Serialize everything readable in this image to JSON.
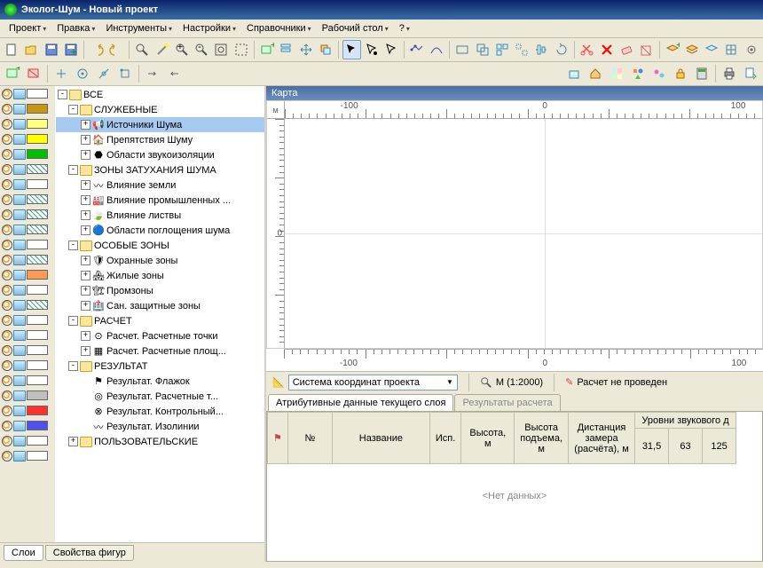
{
  "titlebar": {
    "text": "Эколог-Шум - Новый проект"
  },
  "menu": {
    "project": "Проект",
    "edit": "Правка",
    "tools": "Инструменты",
    "settings": "Настройки",
    "refs": "Справочники",
    "desktop": "Рабочий стол",
    "help": "?"
  },
  "left_tabs": {
    "layers": "Слои",
    "props": "Свойства фигур"
  },
  "tree": {
    "all": "ВСЕ",
    "service": "СЛУЖЕБНЫЕ",
    "noise_sources": "Источники Шума",
    "obstacles": "Препятствия Шуму",
    "sound_iso": "Области звукоизоляции",
    "atten_zones": "ЗОНЫ ЗАТУХАНИЯ ШУМА",
    "ground": "Влияние земли",
    "industrial": "Влияние промышленных ...",
    "foliage": "Влияние листвы",
    "absorb": "Области поглощения шума",
    "special": "ОСОБЫЕ ЗОНЫ",
    "protected": "Охранные зоны",
    "residential": "Жилые зоны",
    "industrial_z": "Промзоны",
    "sanitary": "Сан. защитные зоны",
    "calc": "РАСЧЕТ",
    "calc_points": "Расчет. Расчетные точки",
    "calc_areas": "Расчет. Расчетные площ...",
    "result": "РЕЗУЛЬТАТ",
    "res_flag": "Результат. Флажок",
    "res_points": "Результат. Расчетные т...",
    "res_control": "Результат. Контрольный...",
    "res_iso": "Результат. Изолинии",
    "user": "ПОЛЬЗОВАТЕЛЬСКИЕ"
  },
  "swatch_colors": [
    "#ffffff",
    "#c89614",
    "#ffff80",
    "#ffff00",
    "#00c000",
    "#ffffff",
    "#ffffff",
    "#ffffff",
    "#ffffff",
    "#ffffff",
    "#ffffff",
    "#ffffff",
    "#ff9955",
    "#ffffff",
    "#ffffff",
    "#ffffff",
    "#ffffff",
    "#ffffff",
    "#ffffff",
    "#ffffff",
    "#c0c0c0",
    "#ff3030",
    "#5050f0",
    "#ffffff",
    "#ffffff"
  ],
  "swatch_hatches": [
    false,
    false,
    false,
    false,
    false,
    true,
    false,
    true,
    true,
    true,
    false,
    true,
    false,
    false,
    true,
    false,
    false,
    false,
    false,
    false,
    false,
    false,
    false,
    false,
    false
  ],
  "map": {
    "title": "Карта",
    "unit": "м",
    "ticks_top": [
      "-100",
      "0",
      "100"
    ],
    "ticks_bottom": [
      "-100",
      "0",
      "100"
    ]
  },
  "status": {
    "coord_system": "Система координат проекта",
    "scale": "М (1:2000)",
    "calc_status": "Расчет не проведен"
  },
  "att_tabs": {
    "t1": "Атрибутивные данные текущего слоя",
    "t2": "Результаты расчета"
  },
  "grid": {
    "group": "Уровни звукового д",
    "cols": {
      "n": "№",
      "name": "Название",
      "isp": "Исп.",
      "h": "Высота, м",
      "hraise": "Высота подъема, м",
      "dist": "Дистанция замера (расчёта), м",
      "c1": "31,5",
      "c2": "63",
      "c3": "125"
    },
    "empty": "<Нет данных>"
  }
}
